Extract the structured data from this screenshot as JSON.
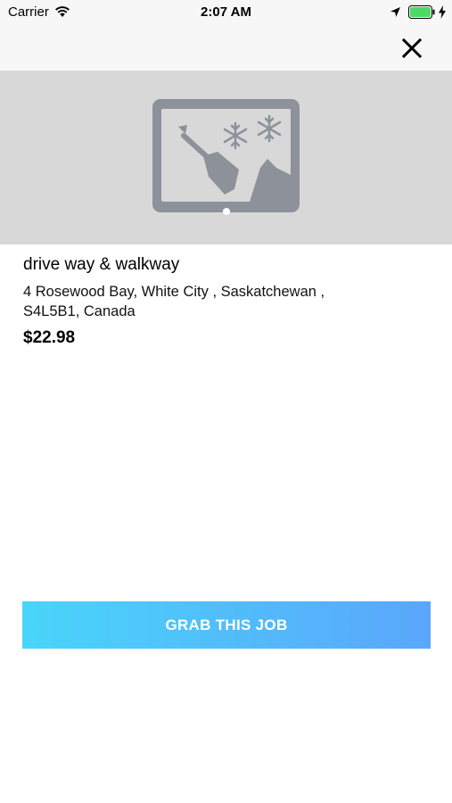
{
  "status_bar": {
    "carrier": "Carrier",
    "time": "2:07 AM",
    "battery_color": "#4cd964"
  },
  "nav": {
    "close_icon": "close-icon"
  },
  "hero": {
    "placeholder_icon": "snow-shovel-image-placeholder-icon",
    "page_count": 1,
    "current_page": 1
  },
  "job": {
    "title": "drive way & walkway",
    "address_line1": "4 Rosewood Bay, White City , Saskatchewan ,",
    "address_line2": "S4L5B1, Canada",
    "price": "$22.98"
  },
  "actions": {
    "grab_label": "GRAB THIS JOB",
    "gradient_start": "#49d5fa",
    "gradient_end": "#5aa6fb"
  }
}
